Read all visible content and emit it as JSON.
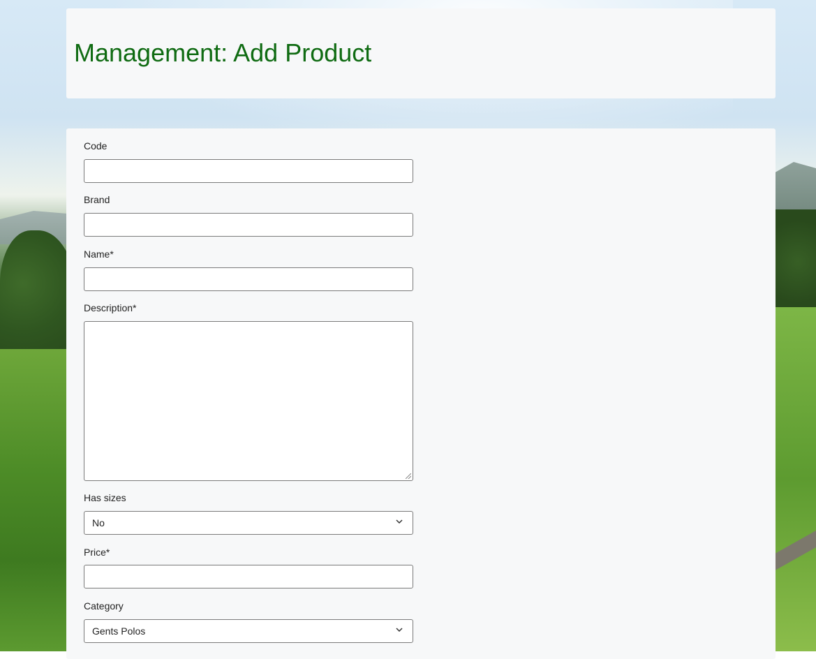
{
  "header": {
    "title": "Management: Add Product"
  },
  "form": {
    "code": {
      "label": "Code",
      "value": ""
    },
    "brand": {
      "label": "Brand",
      "value": ""
    },
    "name": {
      "label": "Name*",
      "value": ""
    },
    "description": {
      "label": "Description*",
      "value": ""
    },
    "has_sizes": {
      "label": "Has sizes",
      "selected": "No"
    },
    "price": {
      "label": "Price*",
      "value": ""
    },
    "category": {
      "label": "Category",
      "selected": "Gents Polos"
    }
  },
  "colors": {
    "title": "#0f6b12",
    "card_bg": "#f7f8f9",
    "input_border": "#7a7a7a"
  },
  "icons": {
    "select_arrow": "chevron-down-icon"
  }
}
